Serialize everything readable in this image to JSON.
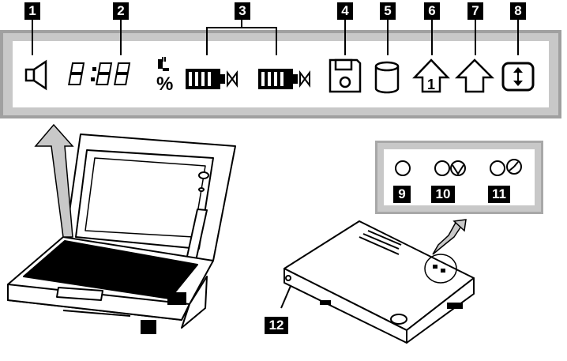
{
  "callouts": {
    "n1": "1",
    "n2": "2",
    "n3": "3",
    "n4": "4",
    "n5": "5",
    "n6": "6",
    "n7": "7",
    "n8": "8",
    "n9": "9",
    "n10": "10",
    "n11": "11",
    "n12": "12"
  },
  "status_icons": [
    {
      "id": 1,
      "icon": "speaker-icon"
    },
    {
      "id": 2,
      "icon": "clock-digits-icon",
      "digits": "8:88",
      "suffix": "%"
    },
    {
      "id": 3,
      "icon": "battery-icon",
      "count": 2
    },
    {
      "id": 4,
      "icon": "diskette-icon"
    },
    {
      "id": 5,
      "icon": "hard-disk-icon"
    },
    {
      "id": 6,
      "icon": "numlock-icon",
      "glyph": "1"
    },
    {
      "id": 7,
      "icon": "caps-lock-icon"
    },
    {
      "id": 8,
      "icon": "scroll-lock-icon"
    }
  ],
  "indicator_leds": [
    {
      "id": 9,
      "icon": "led-icon"
    },
    {
      "id": 10,
      "icon": "led-suspend-icon"
    },
    {
      "id": 11,
      "icon": "led-power-icon"
    }
  ],
  "lcd": {
    "digits": "8:88",
    "percent": "%"
  },
  "numlock_glyph": "1"
}
